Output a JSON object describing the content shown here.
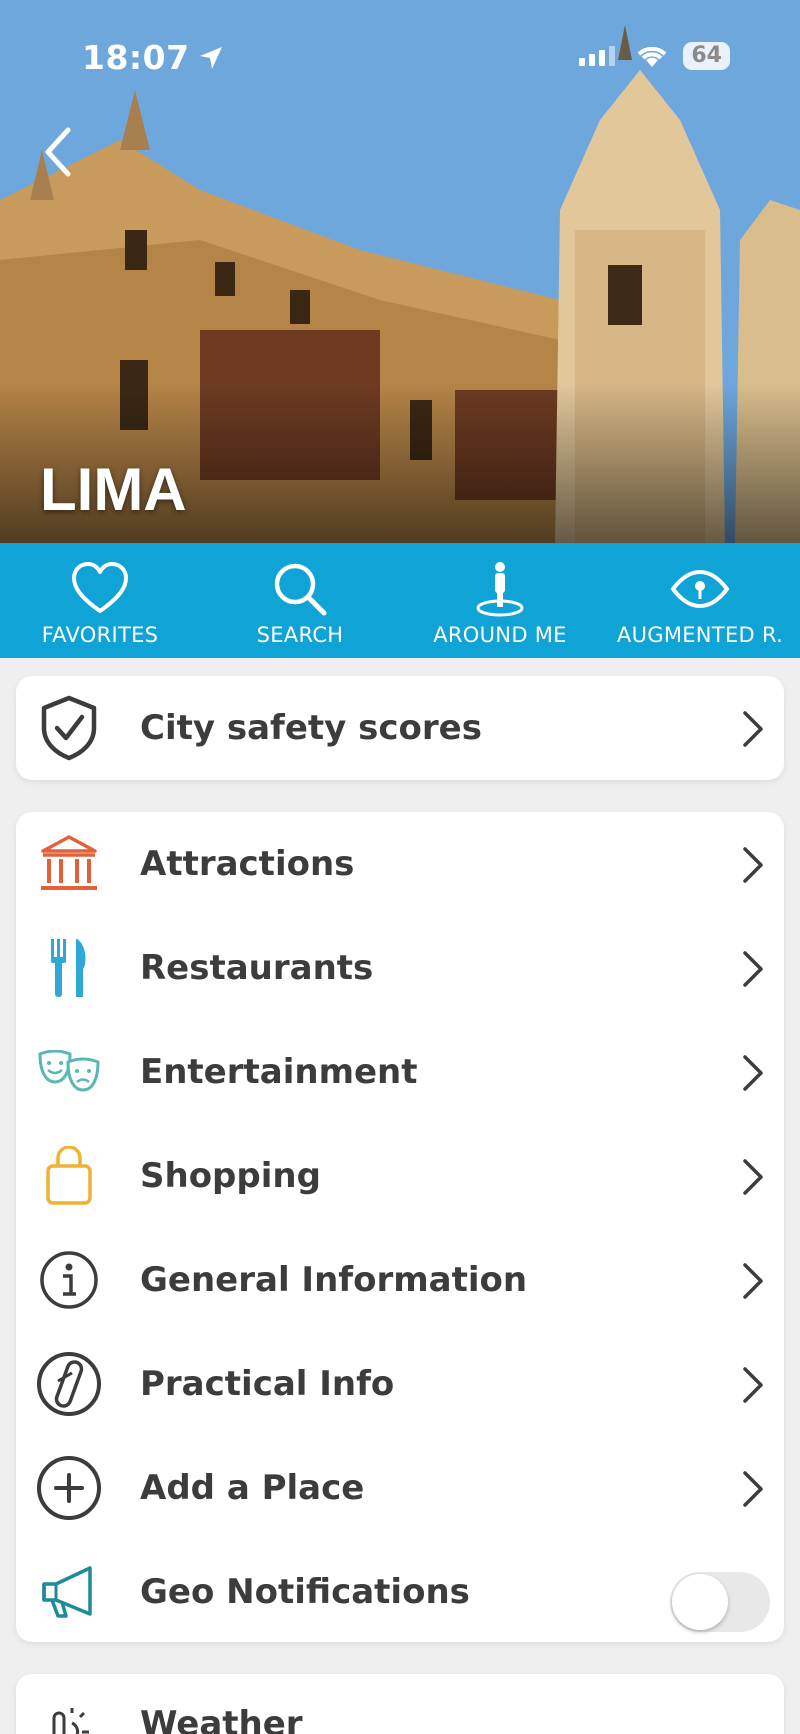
{
  "status": {
    "time": "18:07",
    "battery": "64"
  },
  "hero": {
    "city": "LIMA"
  },
  "tabs": [
    {
      "label": "FAVORITES",
      "icon": "heart-icon"
    },
    {
      "label": "SEARCH",
      "icon": "search-icon"
    },
    {
      "label": "AROUND ME",
      "icon": "around-me-icon"
    },
    {
      "label": "AUGMENTED R.",
      "icon": "eye-icon"
    }
  ],
  "safety": {
    "label": "City safety scores",
    "icon": "shield-check-icon"
  },
  "menu": [
    {
      "label": "Attractions",
      "icon": "museum-icon",
      "color": "#e2603a"
    },
    {
      "label": "Restaurants",
      "icon": "fork-knife-icon",
      "color": "#2fa8d8"
    },
    {
      "label": "Entertainment",
      "icon": "theater-masks-icon",
      "color": "#5ab8b0"
    },
    {
      "label": "Shopping",
      "icon": "shopping-bag-icon",
      "color": "#f0b232"
    },
    {
      "label": "General Information",
      "icon": "info-icon",
      "color": "#3c3c3c"
    },
    {
      "label": "Practical Info",
      "icon": "swiss-knife-icon",
      "color": "#3c3c3c"
    },
    {
      "label": "Add a Place",
      "icon": "plus-circle-icon",
      "color": "#3c3c3c"
    },
    {
      "label": "Geo Notifications",
      "icon": "megaphone-icon",
      "color": "#1f8a98",
      "toggle": false
    }
  ],
  "weather": {
    "label": "Weather",
    "icon": "thermometer-sun-icon"
  },
  "colors": {
    "tabbar": "#0fa3d6",
    "background": "#efefef"
  }
}
